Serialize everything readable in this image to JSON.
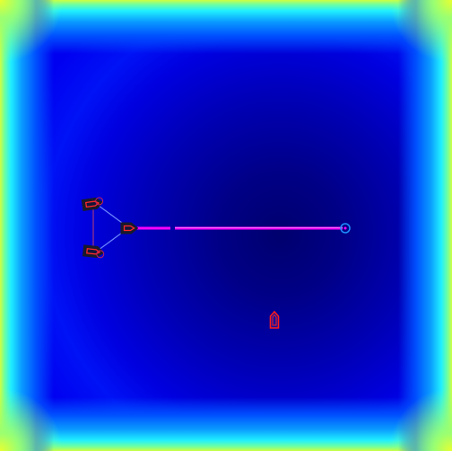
{
  "scene": {
    "palette": {
      "field_core": "#00006e",
      "field_body": "#0000e0",
      "field_rim": "#20f0ff",
      "field_corner": "#e8ff30",
      "beam": "#ff00ff",
      "unit_outline": "#ff1a1a",
      "unit_body": "#101040",
      "link_lines": "#a0a0ff",
      "target_marker": "#1e90ff"
    },
    "units": [
      {
        "name": "squad-unit-upper",
        "icon": "boat-icon"
      },
      {
        "name": "squad-unit-lower",
        "icon": "boat-icon"
      },
      {
        "name": "squad-unit-lead",
        "icon": "boat-icon"
      },
      {
        "name": "lone-unit",
        "icon": "boat-icon"
      }
    ],
    "target": {
      "icon": "target-ring-icon"
    },
    "beam": {
      "icon": "laser-beam"
    }
  }
}
